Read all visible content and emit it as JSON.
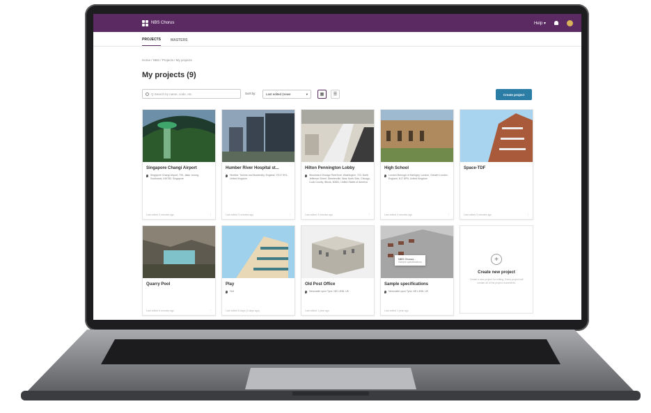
{
  "app": {
    "name": "NBS Chorus",
    "help_label": "Help ▾"
  },
  "tabs": [
    {
      "label": "PROJECTS"
    },
    {
      "label": "MASTERS"
    }
  ],
  "breadcrumb": "Home / NBS / Projects / My projects",
  "page_title": "My projects (9)",
  "toolbar": {
    "search_placeholder": "Q Search by name, code, etc.",
    "sort_label": "Sort by:",
    "sort_value": "Last edited (newe",
    "create_label": "Create project"
  },
  "projects": [
    {
      "title": "Singapore Changi Airport",
      "location": "Singapore Changi Airport, 709, Jalan Jurong, Southwest, 049783, Singapore",
      "edited": "Last edited 3 minutes ago"
    },
    {
      "title": "Humber River Hospital st...",
      "location": "Humber, Toronto and Buckersby, England, YO17 9HL, United Kingdom",
      "edited": "Last edited 3 minutes ago"
    },
    {
      "title": "Hilton Pennington Lobby",
      "location": "Woodward Chicago Riverfront, Washington, 724, North Jefferson Street, Streeterville, Near North Side, Chicago, Cook County, Illinois, 60661, United States of America",
      "edited": "Last edited 3 minutes ago"
    },
    {
      "title": "High School",
      "location": "London Borough of Haringey, London, Greater London, England, N17 8PN, United Kingdom",
      "edited": "Last edited 3 minutes ago"
    },
    {
      "title": "Space-TDF",
      "location": "",
      "edited": "Last edited 3 minutes ago"
    },
    {
      "title": "Quarry Pool",
      "location": "",
      "edited": "Last edited 6 minutes ago"
    },
    {
      "title": "Play",
      "location": "Hull",
      "edited": "Last edited 8 days (3 days ago)"
    },
    {
      "title": "Old Post Office",
      "location": "Newcastle upon Tyne, NE1 4NN, UK",
      "edited": "Last edited 1 year ago"
    },
    {
      "title": "Sample specifications",
      "location": "Newcastle upon Tyne, NE1 4NN, UK",
      "edited": "Last edited 1 year ago"
    }
  ],
  "tooltip": {
    "title": "NBS Chorus -",
    "subtitle": "Sample specifications"
  },
  "new_project": {
    "title": "Create new project",
    "description": "Create a new project for editing, Every project will contain all of the project documents."
  },
  "colors": {
    "appbar": "#5b2a63",
    "primary_button": "#2c7da6"
  }
}
